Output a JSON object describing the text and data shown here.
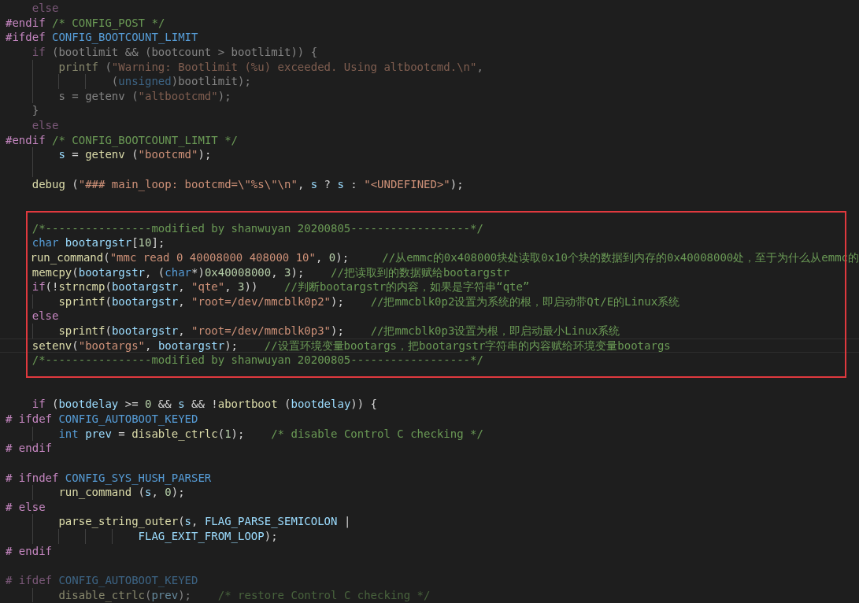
{
  "editor": {
    "lines": [
      {
        "kind": "block",
        "lines": [
          {
            "kind": "code",
            "dimmed": true,
            "tokens": [
              {
                "kind": "kw",
                "text": "else"
              }
            ]
          }
        ]
      },
      {
        "kind": "code",
        "dimmed": false,
        "tokens": [
          {
            "kind": "pp",
            "text": "#endif "
          },
          {
            "kind": "cm",
            "text": "/* CONFIG_POST */"
          }
        ]
      },
      {
        "kind": "code",
        "dimmed": false,
        "tokens": [
          {
            "kind": "pp",
            "text": "#ifdef "
          },
          {
            "kind": "macro",
            "text": "CONFIG_BOOTCOUNT_LIMIT"
          }
        ]
      },
      {
        "kind": "block",
        "lines": [
          {
            "kind": "code",
            "dimmed": true,
            "tokens": [
              {
                "kind": "kw",
                "text": "if"
              },
              {
                "kind": "op",
                "text": " (bootlimit && (bootcount > bootlimit)) {"
              }
            ]
          },
          {
            "kind": "block",
            "lines": [
              {
                "kind": "code",
                "dimmed": true,
                "tokens": [
                  {
                    "kind": "fn",
                    "text": "printf"
                  },
                  {
                    "kind": "op",
                    "text": " ("
                  },
                  {
                    "kind": "str",
                    "text": "\"Warning: Bootlimit (%u) exceeded. Using altbootcmd.\\n\""
                  },
                  {
                    "kind": "op",
                    "text": ","
                  }
                ]
              },
              {
                "kind": "block",
                "lines": [
                  {
                    "kind": "block",
                    "lines": [
                      {
                        "kind": "code",
                        "dimmed": true,
                        "tokens": [
                          {
                            "kind": "op",
                            "text": "("
                          },
                          {
                            "kind": "type",
                            "text": "unsigned"
                          },
                          {
                            "kind": "op",
                            "text": ")bootlimit);"
                          }
                        ]
                      }
                    ]
                  }
                ]
              },
              {
                "kind": "code",
                "dimmed": true,
                "tokens": [
                  {
                    "kind": "op",
                    "text": "s = getenv ("
                  },
                  {
                    "kind": "str",
                    "text": "\"altbootcmd\""
                  },
                  {
                    "kind": "op",
                    "text": ");"
                  }
                ]
              }
            ]
          },
          {
            "kind": "code",
            "dimmed": true,
            "tokens": [
              {
                "kind": "op",
                "text": "}"
              }
            ]
          },
          {
            "kind": "code",
            "dimmed": true,
            "tokens": [
              {
                "kind": "kw",
                "text": "else"
              }
            ]
          }
        ]
      },
      {
        "kind": "code",
        "dimmed": false,
        "tokens": [
          {
            "kind": "pp",
            "text": "#endif "
          },
          {
            "kind": "cm",
            "text": "/* CONFIG_BOOTCOUNT_LIMIT */"
          }
        ]
      },
      {
        "kind": "block",
        "lines": [
          {
            "kind": "block",
            "lines": [
              {
                "kind": "code",
                "dimmed": false,
                "tokens": [
                  {
                    "kind": "var",
                    "text": "s"
                  },
                  {
                    "kind": "op",
                    "text": " = "
                  },
                  {
                    "kind": "fn",
                    "text": "getenv"
                  },
                  {
                    "kind": "op",
                    "text": " ("
                  },
                  {
                    "kind": "str",
                    "text": "\"bootcmd\""
                  },
                  {
                    "kind": "op",
                    "text": ");"
                  }
                ]
              },
              {
                "kind": "blank"
              }
            ]
          },
          {
            "kind": "code",
            "dimmed": false,
            "tokens": [
              {
                "kind": "fn",
                "text": "debug"
              },
              {
                "kind": "op",
                "text": " ("
              },
              {
                "kind": "str",
                "text": "\"### main_loop: bootcmd=\\\"%s\\\"\\n\""
              },
              {
                "kind": "op",
                "text": ", "
              },
              {
                "kind": "var",
                "text": "s"
              },
              {
                "kind": "op",
                "text": " ? "
              },
              {
                "kind": "var",
                "text": "s"
              },
              {
                "kind": "op",
                "text": " : "
              },
              {
                "kind": "str",
                "text": "\"<UNDEFINED>\""
              },
              {
                "kind": "op",
                "text": ");"
              }
            ]
          },
          {
            "kind": "blank"
          },
          {
            "kind": "box",
            "lines": [
              {
                "kind": "blank"
              },
              {
                "kind": "code",
                "current": false,
                "tokens": [
                  {
                    "kind": "cm",
                    "text": "/*----------------modified by shanwuyan 20200805------------------*/"
                  }
                ]
              },
              {
                "kind": "code",
                "current": false,
                "tokens": [
                  {
                    "kind": "type",
                    "text": "char "
                  },
                  {
                    "kind": "var",
                    "text": "bootargstr"
                  },
                  {
                    "kind": "op",
                    "text": "["
                  },
                  {
                    "kind": "num",
                    "text": "10"
                  },
                  {
                    "kind": "op",
                    "text": "];"
                  }
                ]
              },
              {
                "kind": "code",
                "current": false,
                "tokens": [
                  {
                    "kind": "fn",
                    "text": "run_command"
                  },
                  {
                    "kind": "op",
                    "text": "("
                  },
                  {
                    "kind": "str",
                    "text": "\"mmc read 0 40008000 408000 10\""
                  },
                  {
                    "kind": "op",
                    "text": ", "
                  },
                  {
                    "kind": "num",
                    "text": "0"
                  },
                  {
                    "kind": "op",
                    "text": ");     "
                  },
                  {
                    "kind": "cm",
                    "text": "//从emmc的0x408000块处读取0x10个块的数据到内存的0x40008000处，至于为什么从emmc的"
                  }
                ]
              },
              {
                "kind": "code",
                "current": false,
                "tokens": [
                  {
                    "kind": "fn",
                    "text": "memcpy"
                  },
                  {
                    "kind": "op",
                    "text": "("
                  },
                  {
                    "kind": "var",
                    "text": "bootargstr"
                  },
                  {
                    "kind": "op",
                    "text": ", ("
                  },
                  {
                    "kind": "type",
                    "text": "char"
                  },
                  {
                    "kind": "op",
                    "text": "*)"
                  },
                  {
                    "kind": "num",
                    "text": "0x40008000"
                  },
                  {
                    "kind": "op",
                    "text": ", "
                  },
                  {
                    "kind": "num",
                    "text": "3"
                  },
                  {
                    "kind": "op",
                    "text": ");    "
                  },
                  {
                    "kind": "cm",
                    "text": "//把读取到的数据赋给bootargstr"
                  }
                ]
              },
              {
                "kind": "code",
                "current": false,
                "tokens": [
                  {
                    "kind": "kw",
                    "text": "if"
                  },
                  {
                    "kind": "op",
                    "text": "(!"
                  },
                  {
                    "kind": "fn",
                    "text": "strncmp"
                  },
                  {
                    "kind": "op",
                    "text": "("
                  },
                  {
                    "kind": "var",
                    "text": "bootargstr"
                  },
                  {
                    "kind": "op",
                    "text": ", "
                  },
                  {
                    "kind": "str",
                    "text": "\"qte\""
                  },
                  {
                    "kind": "op",
                    "text": ", "
                  },
                  {
                    "kind": "num",
                    "text": "3"
                  },
                  {
                    "kind": "op",
                    "text": "))    "
                  },
                  {
                    "kind": "cm",
                    "text": "//判断bootargstr的内容，如果是字符串“qte”"
                  }
                ]
              },
              {
                "kind": "block",
                "lines": [
                  {
                    "kind": "code",
                    "current": false,
                    "tokens": [
                      {
                        "kind": "fn",
                        "text": "sprintf"
                      },
                      {
                        "kind": "op",
                        "text": "("
                      },
                      {
                        "kind": "var",
                        "text": "bootargstr"
                      },
                      {
                        "kind": "op",
                        "text": ", "
                      },
                      {
                        "kind": "str",
                        "text": "\"root=/dev/mmcblk0p2\""
                      },
                      {
                        "kind": "op",
                        "text": ");    "
                      },
                      {
                        "kind": "cm",
                        "text": "//把mmcblk0p2设置为系统的根，即启动带Qt/E的Linux系统"
                      }
                    ]
                  }
                ]
              },
              {
                "kind": "code",
                "current": false,
                "tokens": [
                  {
                    "kind": "kw",
                    "text": "else"
                  }
                ]
              },
              {
                "kind": "block",
                "lines": [
                  {
                    "kind": "code",
                    "current": false,
                    "tokens": [
                      {
                        "kind": "fn",
                        "text": "sprintf"
                      },
                      {
                        "kind": "op",
                        "text": "("
                      },
                      {
                        "kind": "var",
                        "text": "bootargstr"
                      },
                      {
                        "kind": "op",
                        "text": ", "
                      },
                      {
                        "kind": "str",
                        "text": "\"root=/dev/mmcblk0p3\""
                      },
                      {
                        "kind": "op",
                        "text": ");    "
                      },
                      {
                        "kind": "cm",
                        "text": "//把mmcblk0p3设置为根，即启动最小Linux系统"
                      }
                    ]
                  }
                ]
              },
              {
                "kind": "code",
                "current": true,
                "tokens": [
                  {
                    "kind": "fn",
                    "text": "setenv"
                  },
                  {
                    "kind": "op",
                    "text": "("
                  },
                  {
                    "kind": "str",
                    "text": "\"bootargs\""
                  },
                  {
                    "kind": "op",
                    "text": ", "
                  },
                  {
                    "kind": "var",
                    "text": "bootargstr"
                  },
                  {
                    "kind": "op",
                    "text": ");    "
                  },
                  {
                    "kind": "cm",
                    "text": "//设置环境变量bootargs，把bootargstr字符串的内容赋给环境变量bootargs"
                  }
                ]
              },
              {
                "kind": "code",
                "current": false,
                "tokens": [
                  {
                    "kind": "cm",
                    "text": "/*----------------modified by shanwuyan 20200805------------------*/"
                  }
                ]
              },
              {
                "kind": "blank"
              }
            ]
          }
        ]
      },
      {
        "kind": "blank"
      },
      {
        "kind": "block",
        "lines": [
          {
            "kind": "code",
            "dimmed": false,
            "tokens": [
              {
                "kind": "kw",
                "text": "if"
              },
              {
                "kind": "op",
                "text": " ("
              },
              {
                "kind": "var",
                "text": "bootdelay"
              },
              {
                "kind": "op",
                "text": " >= "
              },
              {
                "kind": "num",
                "text": "0"
              },
              {
                "kind": "op",
                "text": " && "
              },
              {
                "kind": "var",
                "text": "s"
              },
              {
                "kind": "op",
                "text": " && !"
              },
              {
                "kind": "fn",
                "text": "abortboot"
              },
              {
                "kind": "op",
                "text": " ("
              },
              {
                "kind": "var",
                "text": "bootdelay"
              },
              {
                "kind": "op",
                "text": ")) {"
              }
            ]
          }
        ]
      },
      {
        "kind": "code",
        "dimmed": false,
        "tokens": [
          {
            "kind": "pp",
            "text": "# ifdef "
          },
          {
            "kind": "macro",
            "text": "CONFIG_AUTOBOOT_KEYED"
          }
        ]
      },
      {
        "kind": "block",
        "lines": [
          {
            "kind": "block",
            "lines": [
              {
                "kind": "code",
                "dimmed": false,
                "tokens": [
                  {
                    "kind": "type",
                    "text": "int "
                  },
                  {
                    "kind": "var",
                    "text": "prev"
                  },
                  {
                    "kind": "op",
                    "text": " = "
                  },
                  {
                    "kind": "fn",
                    "text": "disable_ctrlc"
                  },
                  {
                    "kind": "op",
                    "text": "("
                  },
                  {
                    "kind": "num",
                    "text": "1"
                  },
                  {
                    "kind": "op",
                    "text": ");    "
                  },
                  {
                    "kind": "cm",
                    "text": "/* disable Control C checking */"
                  }
                ]
              }
            ]
          }
        ]
      },
      {
        "kind": "code",
        "dimmed": false,
        "tokens": [
          {
            "kind": "pp",
            "text": "# endif"
          }
        ]
      },
      {
        "kind": "blank"
      },
      {
        "kind": "code",
        "dimmed": false,
        "tokens": [
          {
            "kind": "pp",
            "text": "# ifndef "
          },
          {
            "kind": "macro",
            "text": "CONFIG_SYS_HUSH_PARSER"
          }
        ]
      },
      {
        "kind": "block",
        "lines": [
          {
            "kind": "block",
            "lines": [
              {
                "kind": "code",
                "dimmed": false,
                "tokens": [
                  {
                    "kind": "fn",
                    "text": "run_command"
                  },
                  {
                    "kind": "op",
                    "text": " ("
                  },
                  {
                    "kind": "var",
                    "text": "s"
                  },
                  {
                    "kind": "op",
                    "text": ", "
                  },
                  {
                    "kind": "num",
                    "text": "0"
                  },
                  {
                    "kind": "op",
                    "text": ");"
                  }
                ]
              }
            ]
          }
        ]
      },
      {
        "kind": "code",
        "dimmed": false,
        "tokens": [
          {
            "kind": "pp",
            "text": "# else"
          }
        ]
      },
      {
        "kind": "block",
        "lines": [
          {
            "kind": "block",
            "lines": [
              {
                "kind": "code",
                "dimmed": false,
                "tokens": [
                  {
                    "kind": "fn",
                    "text": "parse_string_outer"
                  },
                  {
                    "kind": "op",
                    "text": "("
                  },
                  {
                    "kind": "var",
                    "text": "s"
                  },
                  {
                    "kind": "op",
                    "text": ", "
                  },
                  {
                    "kind": "var",
                    "text": "FLAG_PARSE_SEMICOLON"
                  },
                  {
                    "kind": "op",
                    "text": " |"
                  }
                ]
              },
              {
                "kind": "block",
                "lines": [
                  {
                    "kind": "block",
                    "lines": [
                      {
                        "kind": "block",
                        "lines": [
                          {
                            "kind": "code",
                            "dimmed": false,
                            "tokens": [
                              {
                                "kind": "var",
                                "text": "FLAG_EXIT_FROM_LOOP"
                              },
                              {
                                "kind": "op",
                                "text": ");"
                              }
                            ]
                          }
                        ]
                      }
                    ]
                  }
                ]
              }
            ]
          }
        ]
      },
      {
        "kind": "code",
        "dimmed": false,
        "tokens": [
          {
            "kind": "pp",
            "text": "# endif"
          }
        ]
      },
      {
        "kind": "blank"
      },
      {
        "kind": "code",
        "dimmed": true,
        "tokens": [
          {
            "kind": "pp",
            "text": "# ifdef "
          },
          {
            "kind": "macro",
            "text": "CONFIG_AUTOBOOT_KEYED"
          }
        ]
      },
      {
        "kind": "block",
        "lines": [
          {
            "kind": "block",
            "lines": [
              {
                "kind": "code",
                "dimmed": true,
                "tokens": [
                  {
                    "kind": "fn",
                    "text": "disable_ctrlc"
                  },
                  {
                    "kind": "op",
                    "text": "("
                  },
                  {
                    "kind": "var",
                    "text": "prev"
                  },
                  {
                    "kind": "op",
                    "text": ");    "
                  },
                  {
                    "kind": "cm",
                    "text": "/* restore Control C checking */"
                  }
                ]
              }
            ]
          }
        ]
      }
    ]
  }
}
